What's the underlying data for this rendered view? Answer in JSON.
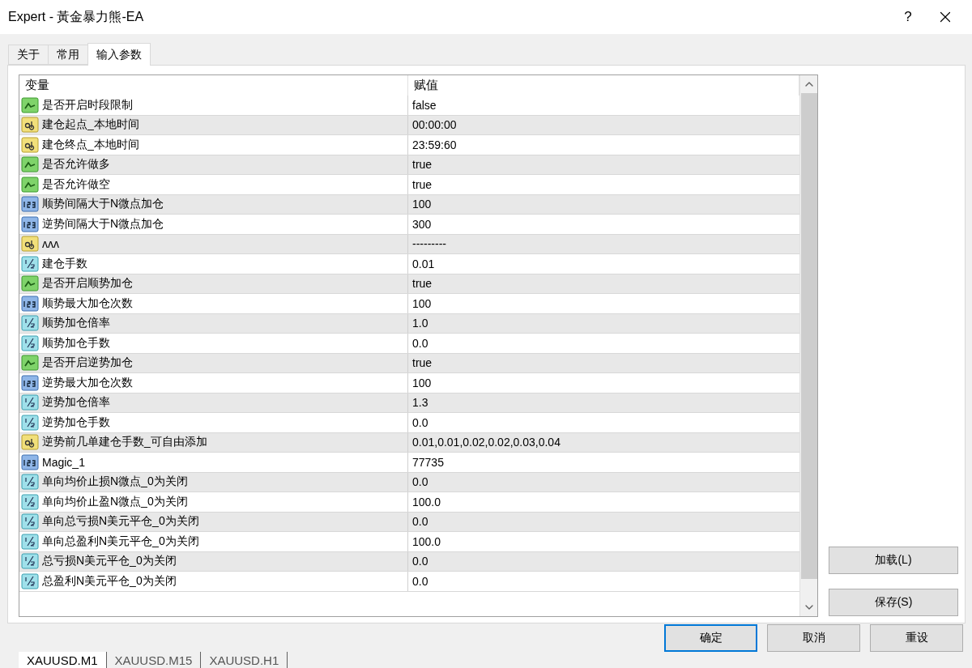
{
  "window": {
    "title": "Expert - 黃金暴力熊-EA",
    "help": "?"
  },
  "tabs": [
    {
      "label": "关于",
      "selected": false
    },
    {
      "label": "常用",
      "selected": false
    },
    {
      "label": "输入参数",
      "selected": true
    }
  ],
  "table": {
    "columns": [
      "变量",
      "赋值"
    ],
    "rows": [
      {
        "kind": "bool",
        "name": "是否开启时段限制",
        "value": "false"
      },
      {
        "kind": "string",
        "name": "建仓起点_本地时间",
        "value": "00:00:00"
      },
      {
        "kind": "string",
        "name": "建仓终点_本地时间",
        "value": "23:59:60"
      },
      {
        "kind": "bool",
        "name": "是否允许做多",
        "value": "true"
      },
      {
        "kind": "bool",
        "name": "是否允许做空",
        "value": "true"
      },
      {
        "kind": "int",
        "name": "顺势间隔大于N微点加仓",
        "value": "100"
      },
      {
        "kind": "int",
        "name": "逆势间隔大于N微点加仓",
        "value": "300"
      },
      {
        "kind": "string",
        "name": "ʌʌʌ",
        "value": "---------"
      },
      {
        "kind": "double",
        "name": "建仓手数",
        "value": "0.01"
      },
      {
        "kind": "bool",
        "name": "是否开启顺势加仓",
        "value": "true"
      },
      {
        "kind": "int",
        "name": "顺势最大加仓次数",
        "value": "100"
      },
      {
        "kind": "double",
        "name": "顺势加仓倍率",
        "value": "1.0"
      },
      {
        "kind": "double",
        "name": "顺势加仓手数",
        "value": "0.0"
      },
      {
        "kind": "bool",
        "name": "是否开启逆势加仓",
        "value": "true"
      },
      {
        "kind": "int",
        "name": "逆势最大加仓次数",
        "value": "100"
      },
      {
        "kind": "double",
        "name": "逆势加仓倍率",
        "value": "1.3"
      },
      {
        "kind": "double",
        "name": "逆势加仓手数",
        "value": "0.0"
      },
      {
        "kind": "string",
        "name": "逆势前几单建仓手数_可自由添加",
        "value": "0.01,0.01,0.02,0.02,0.03,0.04"
      },
      {
        "kind": "int",
        "name": "Magic_1",
        "value": "77735"
      },
      {
        "kind": "double",
        "name": "单向均价止损N微点_0为关闭",
        "value": "0.0"
      },
      {
        "kind": "double",
        "name": "单向均价止盈N微点_0为关闭",
        "value": "100.0"
      },
      {
        "kind": "double",
        "name": "单向总亏损N美元平仓_0为关闭",
        "value": "0.0"
      },
      {
        "kind": "double",
        "name": "单向总盈利N美元平仓_0为关闭",
        "value": "100.0"
      },
      {
        "kind": "double",
        "name": "总亏损N美元平仓_0为关闭",
        "value": "0.0"
      },
      {
        "kind": "double",
        "name": "总盈利N美元平仓_0为关闭",
        "value": "0.0"
      }
    ]
  },
  "side_buttons": [
    "加载(L)",
    "保存(S)"
  ],
  "buttons": [
    {
      "label": "确定",
      "focused": true
    },
    {
      "label": "取消",
      "focused": false
    },
    {
      "label": "重设",
      "focused": false
    }
  ],
  "chart_tabs": [
    {
      "label": "XAUUSD.M1",
      "selected": true
    },
    {
      "label": "XAUUSD.M15",
      "selected": false
    },
    {
      "label": "XAUUSD.H1",
      "selected": false
    }
  ]
}
